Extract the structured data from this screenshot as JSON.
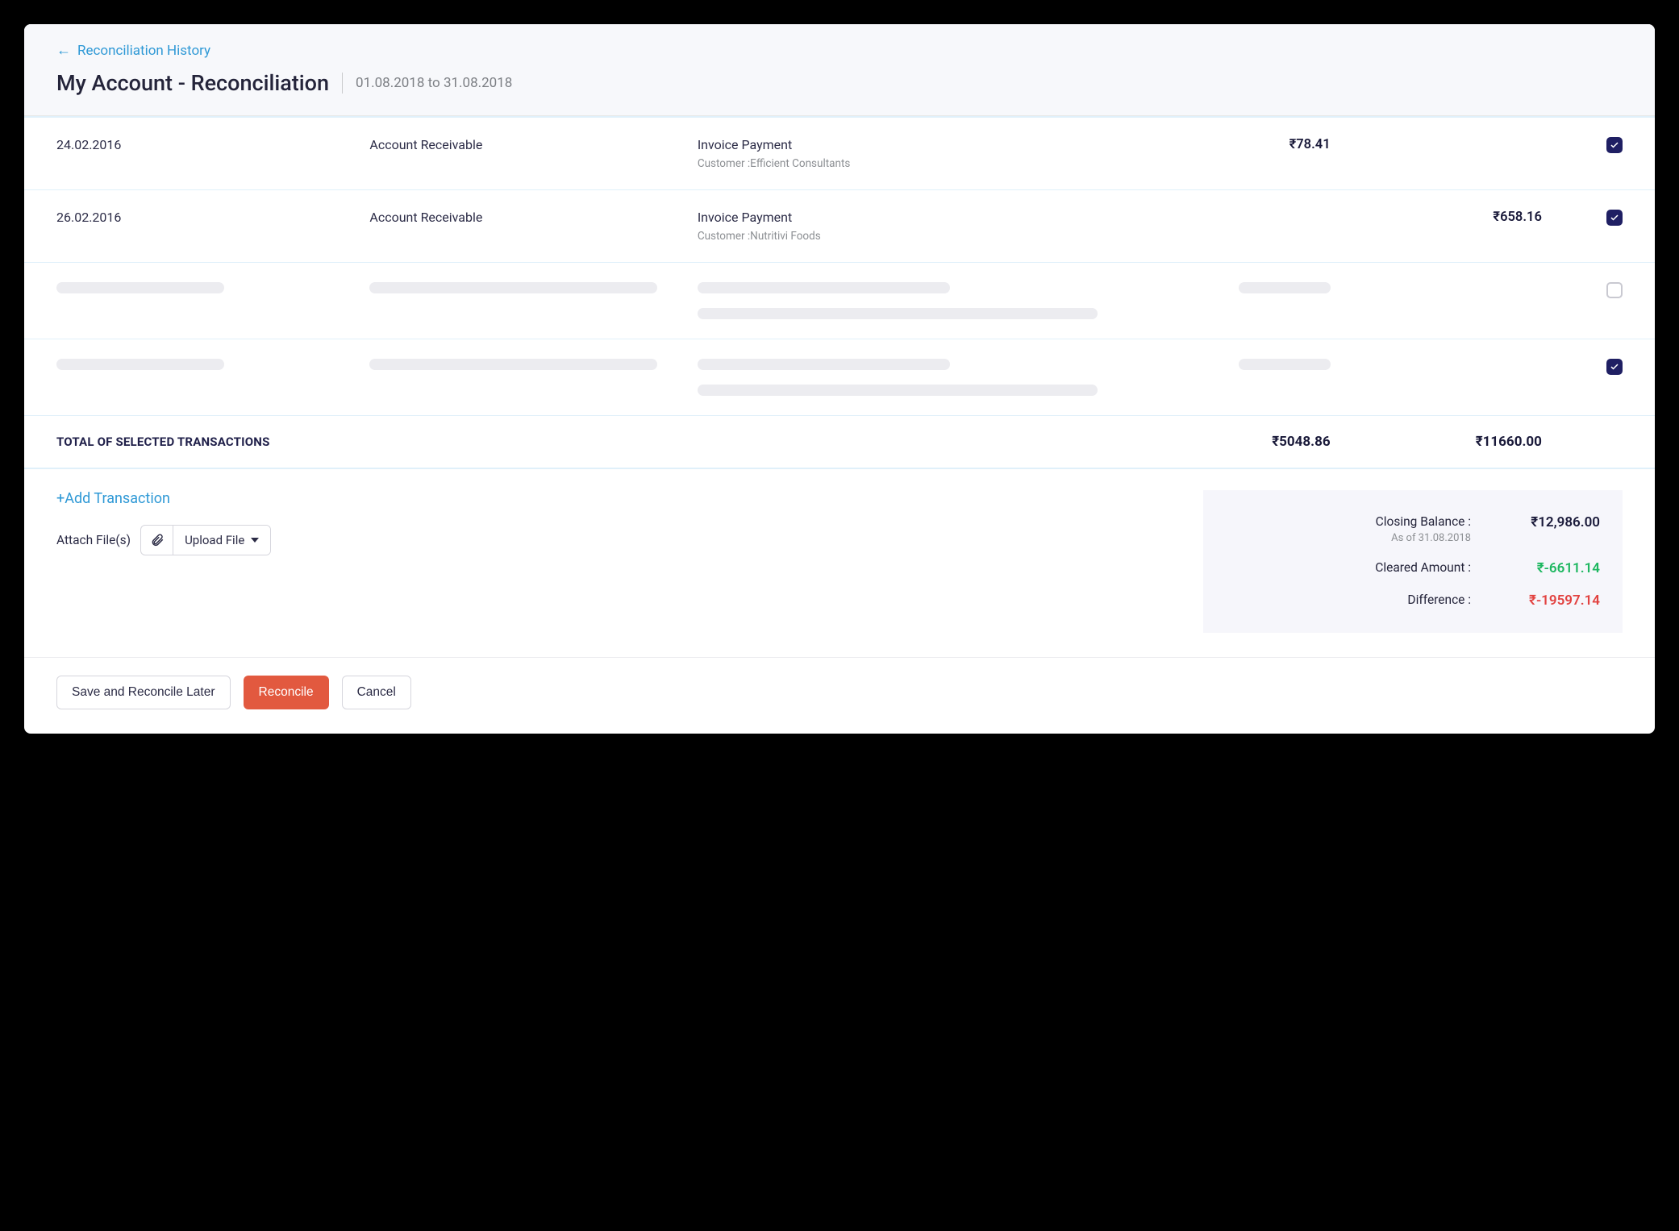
{
  "header": {
    "back_label": "Reconciliation History",
    "page_title": "My Account - Reconciliation",
    "date_range": "01.08.2018 to 31.08.2018"
  },
  "transactions": [
    {
      "date": "24.02.2016",
      "account": "Account Receivable",
      "type": "Invoice Payment",
      "customer": "Customer :Efficient Consultants",
      "amount1": "₹78.41",
      "amount2": "",
      "checked": true,
      "skeleton": false
    },
    {
      "date": "26.02.2016",
      "account": "Account Receivable",
      "type": "Invoice Payment",
      "customer": "Customer :Nutritivi Foods",
      "amount1": "",
      "amount2": "₹658.16",
      "checked": true,
      "skeleton": false
    },
    {
      "skeleton": true,
      "checked": false
    },
    {
      "skeleton": true,
      "checked": true
    }
  ],
  "totals": {
    "label": "TOTAL OF SELECTED TRANSACTIONS",
    "amount1": "₹5048.86",
    "amount2": "₹11660.00"
  },
  "bottom": {
    "add_txn": "+Add Transaction",
    "attach_label": "Attach File(s)",
    "upload_label": "Upload File"
  },
  "summary": {
    "closing_label": "Closing Balance :",
    "closing_sub": "As of 31.08.2018",
    "closing_val": "₹12,986.00",
    "cleared_label": "Cleared Amount :",
    "cleared_val": "₹-6611.14",
    "diff_label": "Difference :",
    "diff_val": "₹-19597.14"
  },
  "footer": {
    "save_label": "Save and Reconcile Later",
    "reconcile_label": "Reconcile",
    "cancel_label": "Cancel"
  }
}
